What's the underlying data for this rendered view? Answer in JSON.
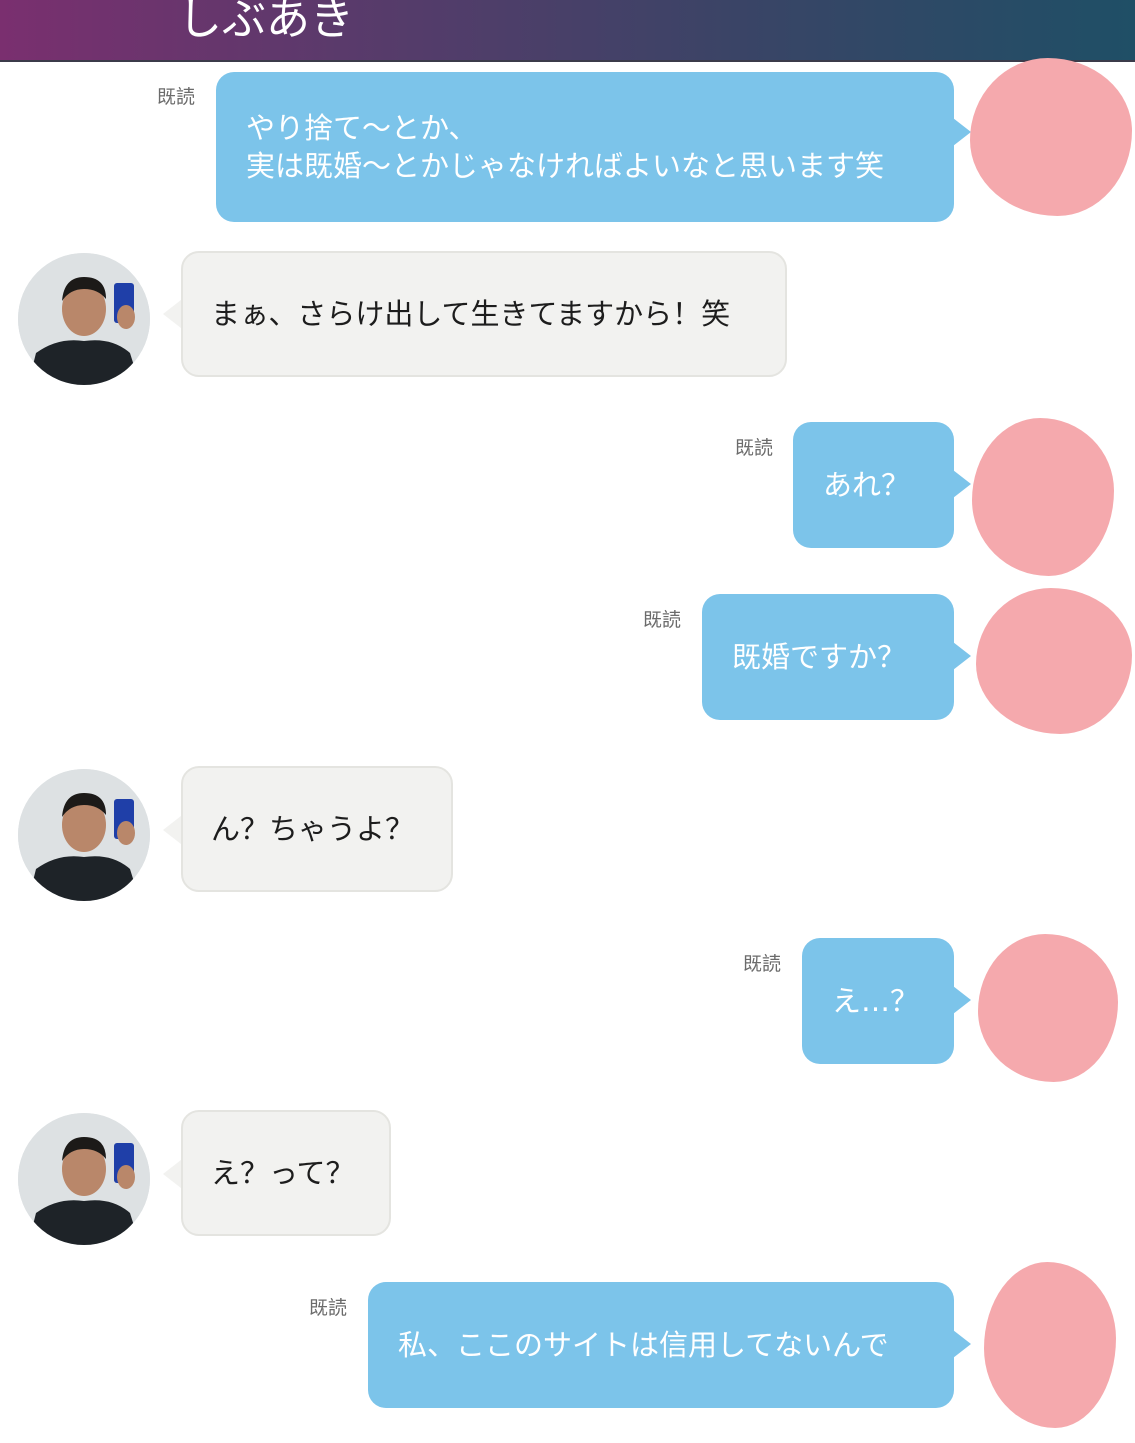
{
  "header": {
    "title": "しぶあき"
  },
  "messages": [
    {
      "side": "out",
      "read": "既読",
      "text": "やり捨て〜とか、\n実は既婚〜とかじゃなければよいなと思います笑"
    },
    {
      "side": "in",
      "text": "まぁ、さらけ出して生きてますから！笑"
    },
    {
      "side": "out",
      "read": "既読",
      "text": "あれ？"
    },
    {
      "side": "out",
      "read": "既読",
      "text": "既婚ですか？"
    },
    {
      "side": "in",
      "text": "ん？ちゃうよ？"
    },
    {
      "side": "out",
      "read": "既読",
      "text": "え…？"
    },
    {
      "side": "in",
      "text": "え？って？"
    },
    {
      "side": "out",
      "read": "既読",
      "text": "私、ここのサイトは信用してないんで"
    }
  ],
  "colors": {
    "outgoing_bubble": "#7cc4ea",
    "incoming_bubble": "#f2f2f0",
    "redaction": "#f5a9ad"
  }
}
